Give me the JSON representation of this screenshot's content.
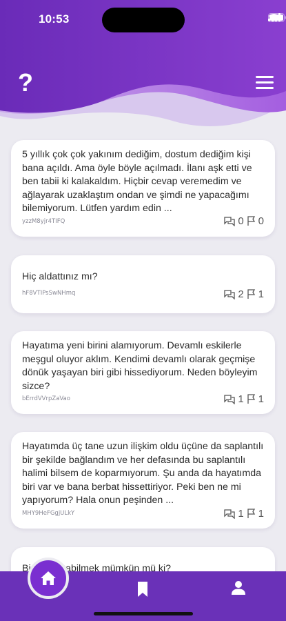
{
  "status_bar": {
    "time": "10:53"
  },
  "header": {
    "help_icon": "?",
    "colors": {
      "purple_dark": "#6a2bb8",
      "purple_light": "#b07be0"
    }
  },
  "posts": [
    {
      "text": "5 yıllık çok çok yakınım dediğim, dostum dediğim kişi bana açıldı. Ama öyle böyle açılmadı. İlanı aşk etti ve ben tabii ki kalakaldım. Hiçbir cevap veremedim ve ağlayarak uzaklaştım ondan ve şimdi ne yapacağımı bilemiyorum. Lütfen yardım edin ...",
      "id": "yzzM8yjr4TIFQ",
      "comments": "0",
      "flags": "0"
    },
    {
      "text": "Hiç aldattınız mı?",
      "id": "hF8VTIPsSwNHmq",
      "comments": "2",
      "flags": "1"
    },
    {
      "text": "Hayatıma yeni birini alamıyorum. Devamlı eskilerle meşgul oluyor aklım. Kendimi devamlı olarak geçmişe dönük yaşayan biri gibi hissediyorum. Neden böyleyim sizce?",
      "id": "bErrdVVrpZaVao",
      "comments": "1",
      "flags": "1"
    },
    {
      "text": "Hayatımda üç tane uzun ilişkim oldu üçüne da saplantılı bir şekilde bağlandım ve her defasında bu saplantılı halimi bilsem de koparmıyorum. Şu anda da hayatımda biri var ve bana berbat hissettiriyor. Peki ben ne mi yapıyorum? Hala onun peşinden ...",
      "id": "MHY9HeFGgjULkY",
      "comments": "1",
      "flags": "1"
    },
    {
      "text": "Birini unutabilmek mümkün mü ki?",
      "id": "yzzW8dhFZQ",
      "comments": "",
      "flags": ""
    }
  ],
  "nav": {
    "items": [
      "home-icon",
      "bookmark-icon",
      "user-icon"
    ],
    "active": "home"
  }
}
